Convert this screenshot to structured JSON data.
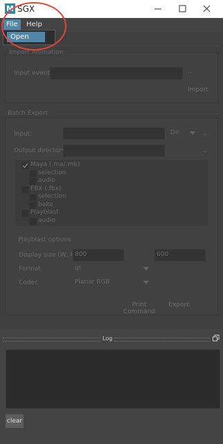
{
  "window": {
    "app_icon_letter": "M",
    "title": "SGX"
  },
  "menu": {
    "file": "File",
    "help": "Help",
    "file_items": [
      "Open"
    ]
  },
  "import_animation": {
    "title": "Import Animation",
    "input_event_label": "Input event:",
    "browse_label": "..",
    "import_button": "Import"
  },
  "batch_export": {
    "title": "Batch Export",
    "input_label": "Input:",
    "input_mode": "Dir",
    "browse_label": "..",
    "output_dir_label": "Output directory:",
    "output_browse_label": "..",
    "tree": [
      {
        "label": "Maya (.ma/.mb)",
        "checked": true,
        "indent": 0
      },
      {
        "label": "selection",
        "checked": false,
        "indent": 1
      },
      {
        "label": "audio",
        "checked": false,
        "indent": 1
      },
      {
        "label": "FBX (.fbx)",
        "checked": false,
        "indent": 0
      },
      {
        "label": "selection",
        "checked": false,
        "indent": 1
      },
      {
        "label": "bake",
        "checked": false,
        "indent": 1
      },
      {
        "label": "Playblast",
        "checked": false,
        "indent": 0
      },
      {
        "label": "audio",
        "checked": false,
        "indent": 1
      }
    ],
    "playblast": {
      "title": "Playblast options",
      "display_size_label": "Display size (W, H)",
      "width": "800",
      "height": "600",
      "format_label": "Format",
      "format_value": "qt",
      "codec_label": "Codec",
      "codec_value": "Planar RGB"
    },
    "print_command_button": "Print Command",
    "export_button": "Export"
  },
  "log": {
    "title": "Log",
    "clear_button": "clear"
  },
  "colors": {
    "accent": "#5285a6",
    "annotation_circle": "#e4473a",
    "app_icon": "#1f8fb5"
  }
}
